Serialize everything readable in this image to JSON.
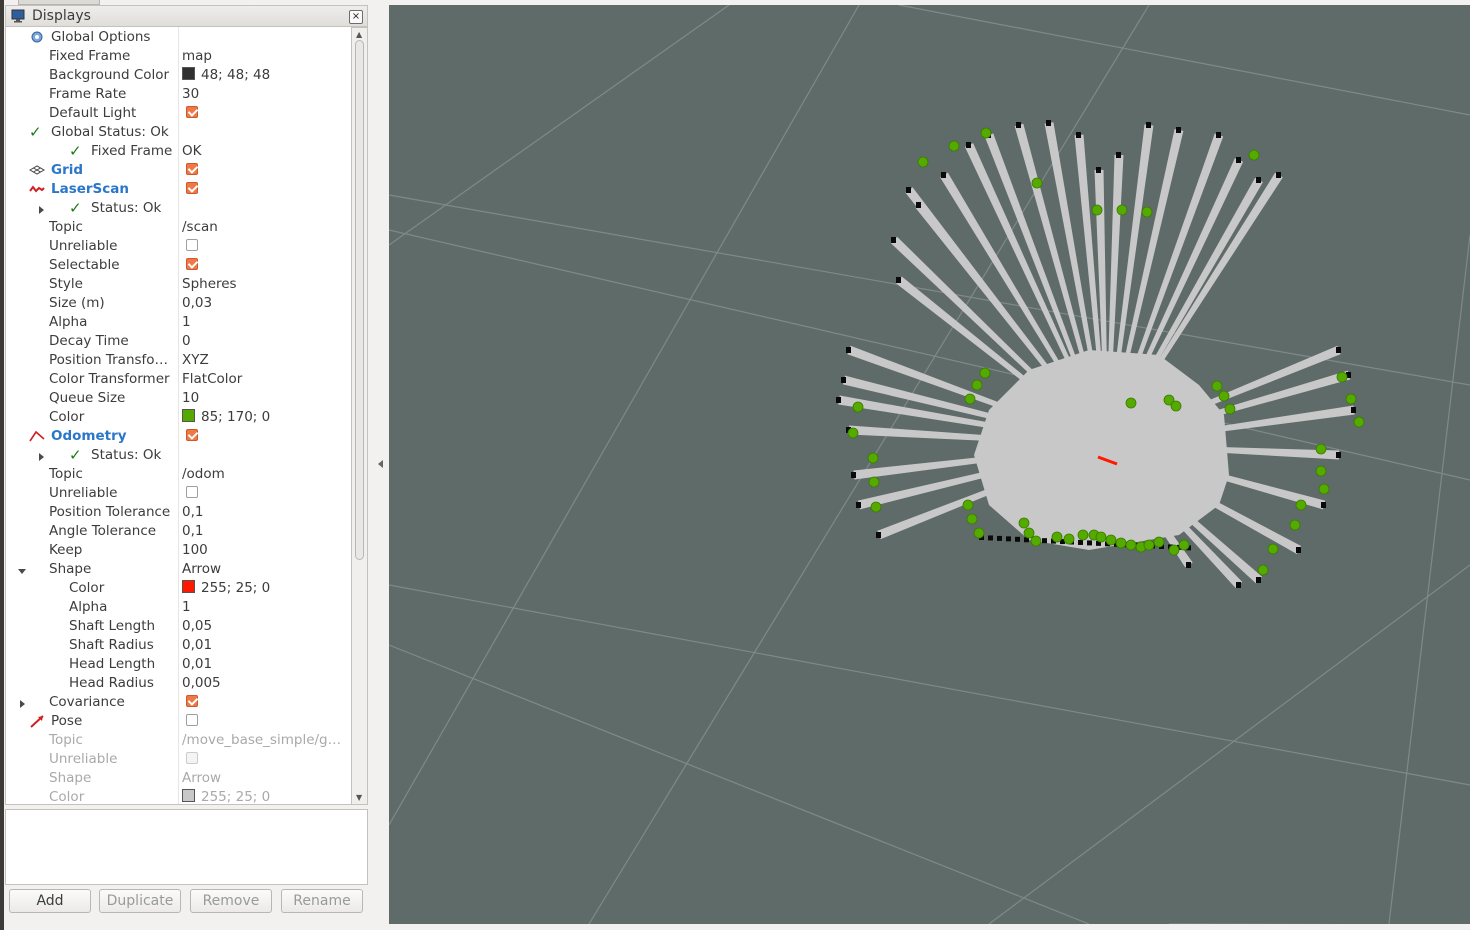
{
  "panel": {
    "title": "Displays",
    "close_glyph": "×",
    "tree": [
      {
        "label": "Global Options",
        "value": "",
        "indent": 1,
        "expander": "down",
        "icon": "gear-icon",
        "style": "normal"
      },
      {
        "label": "Fixed Frame",
        "value": "map",
        "indent": 2
      },
      {
        "label": "Background Color",
        "value": "48; 48; 48",
        "indent": 2,
        "swatch": "#303030"
      },
      {
        "label": "Frame Rate",
        "value": "30",
        "indent": 2
      },
      {
        "label": "Default Light",
        "value": "",
        "indent": 2,
        "check": "on"
      },
      {
        "label": "Global Status: Ok",
        "value": "",
        "indent": 1,
        "expander": "down",
        "icon": "ok-check-icon"
      },
      {
        "label": "Fixed Frame",
        "value": "OK",
        "indent": 3,
        "icon": "ok-check-icon"
      },
      {
        "label": "Grid",
        "value": "",
        "indent": 1,
        "expander": "right",
        "icon": "grid-icon",
        "style": "bold-blue",
        "check": "on"
      },
      {
        "label": "LaserScan",
        "value": "",
        "indent": 1,
        "expander": "down",
        "icon": "laserscan-icon",
        "style": "bold-blue",
        "check": "on"
      },
      {
        "label": "Status: Ok",
        "value": "",
        "indent": 3,
        "expander": "right",
        "icon": "ok-check-icon"
      },
      {
        "label": "Topic",
        "value": "/scan",
        "indent": 2
      },
      {
        "label": "Unreliable",
        "value": "",
        "indent": 2,
        "check": "off"
      },
      {
        "label": "Selectable",
        "value": "",
        "indent": 2,
        "check": "on"
      },
      {
        "label": "Style",
        "value": "Spheres",
        "indent": 2
      },
      {
        "label": "Size (m)",
        "value": "0,03",
        "indent": 2
      },
      {
        "label": "Alpha",
        "value": "1",
        "indent": 2
      },
      {
        "label": "Decay Time",
        "value": "0",
        "indent": 2
      },
      {
        "label": "Position Transfo…",
        "value": "XYZ",
        "indent": 2
      },
      {
        "label": "Color Transformer",
        "value": "FlatColor",
        "indent": 2
      },
      {
        "label": "Queue Size",
        "value": "10",
        "indent": 2
      },
      {
        "label": "Color",
        "value": "85; 170; 0",
        "indent": 2,
        "swatch": "#55aa00"
      },
      {
        "label": "Odometry",
        "value": "",
        "indent": 1,
        "expander": "down",
        "icon": "odometry-icon",
        "style": "bold-blue",
        "check": "on"
      },
      {
        "label": "Status: Ok",
        "value": "",
        "indent": 3,
        "expander": "right",
        "icon": "ok-check-icon"
      },
      {
        "label": "Topic",
        "value": "/odom",
        "indent": 2
      },
      {
        "label": "Unreliable",
        "value": "",
        "indent": 2,
        "check": "off"
      },
      {
        "label": "Position Tolerance",
        "value": "0,1",
        "indent": 2
      },
      {
        "label": "Angle Tolerance",
        "value": "0,1",
        "indent": 2
      },
      {
        "label": "Keep",
        "value": "100",
        "indent": 2
      },
      {
        "label": "Shape",
        "value": "Arrow",
        "indent": 2,
        "expander": "down"
      },
      {
        "label": "Color",
        "value": "255; 25; 0",
        "indent": 3,
        "swatch": "#ff1900"
      },
      {
        "label": "Alpha",
        "value": "1",
        "indent": 3
      },
      {
        "label": "Shaft Length",
        "value": "0,05",
        "indent": 3
      },
      {
        "label": "Shaft Radius",
        "value": "0,01",
        "indent": 3
      },
      {
        "label": "Head Length",
        "value": "0,01",
        "indent": 3
      },
      {
        "label": "Head Radius",
        "value": "0,005",
        "indent": 3
      },
      {
        "label": "Covariance",
        "value": "",
        "indent": 2,
        "expander": "right",
        "check": "on"
      },
      {
        "label": "Pose",
        "value": "",
        "indent": 1,
        "expander": "down",
        "icon": "pose-icon",
        "check": "off"
      },
      {
        "label": "Topic",
        "value": "/move_base_simple/g…",
        "indent": 2,
        "dim": true
      },
      {
        "label": "Unreliable",
        "value": "",
        "indent": 2,
        "dim": true,
        "check": "disabled"
      },
      {
        "label": "Shape",
        "value": "Arrow",
        "indent": 2,
        "dim": true
      },
      {
        "label": "Color",
        "value": "255; 25; 0",
        "indent": 2,
        "dim": true,
        "swatch": "#c8c8c8"
      }
    ]
  },
  "buttons": {
    "add": "Add",
    "duplicate": "Duplicate",
    "remove": "Remove",
    "rename": "Rename"
  },
  "colors": {
    "grid_bg": "#5f6b69",
    "scan_points": "#55aa00",
    "odometry_arrow": "#ff1900",
    "map_free": "#c8c8c8",
    "map_occupied": "#0a0a0a"
  }
}
